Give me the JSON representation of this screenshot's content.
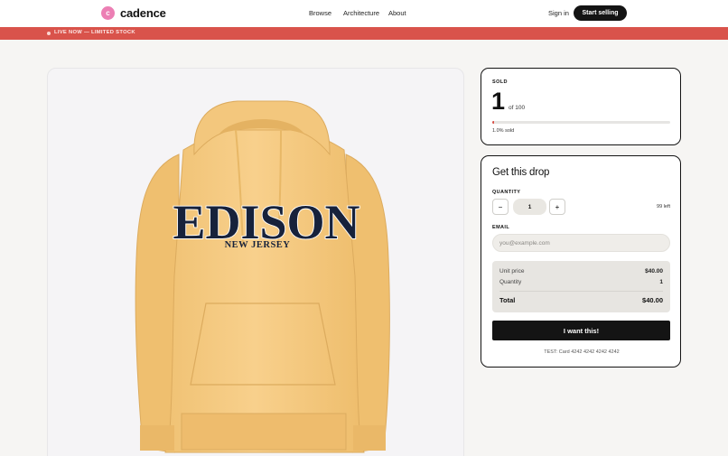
{
  "header": {
    "logo_letter": "c",
    "brand": "cadence",
    "nav": [
      "Browse",
      "Architecture",
      "About"
    ],
    "sign_in": "Sign in",
    "start_selling": "Start selling"
  },
  "banner": {
    "text": "LIVE NOW — LIMITED STOCK",
    "color": "#d9534b"
  },
  "product": {
    "image_icon": "hoodie-image",
    "print_line1": "EDISON",
    "print_line2": "NEW JERSEY"
  },
  "sold": {
    "label": "SOLD",
    "count": "1",
    "of_text": "of 100",
    "progress_fraction": 0.01,
    "percent_text": "1.0% sold"
  },
  "drop": {
    "title": "Get this drop",
    "quantity_label": "QUANTITY",
    "minus": "−",
    "plus": "+",
    "quantity_value": "1",
    "left_text": "99 left",
    "email_label": "EMAIL",
    "email_placeholder": "you@example.com",
    "email_value": "",
    "summary": {
      "unit_price_label": "Unit price",
      "unit_price_value": "$40.00",
      "quantity_label": "Quantity",
      "quantity_value": "1",
      "total_label": "Total",
      "total_value": "$40.00"
    },
    "cta": "I want this!",
    "test_note": "TEST: Card 4242 4242 4242 4242"
  }
}
